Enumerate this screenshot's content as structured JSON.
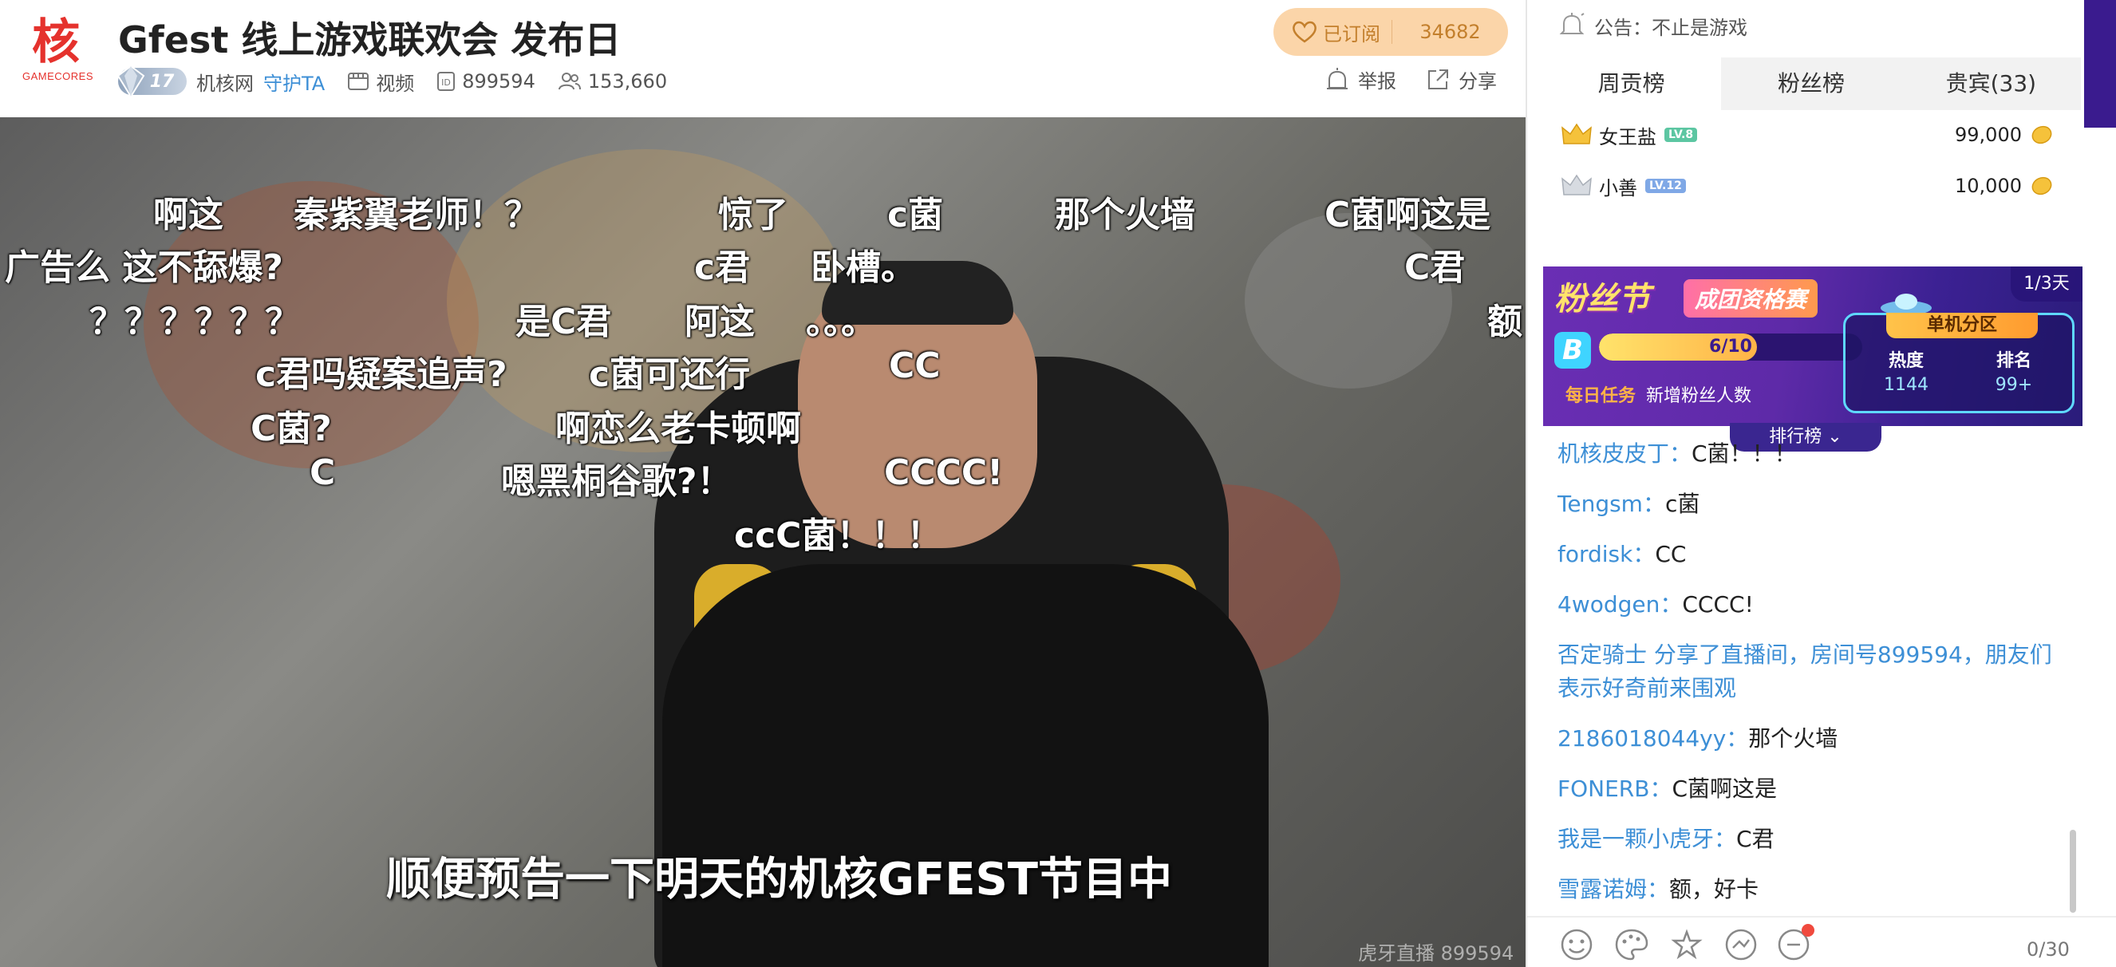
{
  "header": {
    "logo_glyph": "核",
    "logo_text": "GAMECORES",
    "title": "Gfest 线上游戏联欢会 发布日",
    "level": "17",
    "streamer": "机核网",
    "guard_link": "守护TA",
    "category": "视频",
    "room_id": "899594",
    "viewers": "153,660",
    "subscribe_label": "已订阅",
    "subscribe_count": "34682",
    "report_label": "举报",
    "share_label": "分享"
  },
  "video": {
    "danmaku": [
      {
        "text": "啊这",
        "row": 1,
        "col": 192
      },
      {
        "text": "秦紫翼老师！？",
        "row": 1,
        "col": 368
      },
      {
        "text": "惊了",
        "row": 1,
        "col": 900
      },
      {
        "text": "c菌",
        "row": 1,
        "col": 1112
      },
      {
        "text": "那个火墙",
        "row": 1,
        "col": 1322
      },
      {
        "text": "C菌啊这是",
        "row": 1,
        "col": 1660
      },
      {
        "text": "广告么 这不舔爆?",
        "row": 2,
        "col": 6
      },
      {
        "text": "c君",
        "row": 2,
        "col": 870
      },
      {
        "text": "卧槽。",
        "row": 2,
        "col": 1016
      },
      {
        "text": "C君",
        "row": 2,
        "col": 1760
      },
      {
        "text": "？？？？？？",
        "row": 3,
        "col": 112
      },
      {
        "text": "是C君",
        "row": 3,
        "col": 646
      },
      {
        "text": "阿这",
        "row": 3,
        "col": 858
      },
      {
        "text": "。。。",
        "row": 3,
        "col": 1010
      },
      {
        "text": "额",
        "row": 3,
        "col": 1864
      },
      {
        "text": "c君吗疑案追声?",
        "row": 4,
        "col": 320
      },
      {
        "text": "c菌可还行",
        "row": 4,
        "col": 738
      },
      {
        "text": "CC",
        "row": 4,
        "col": 1114
      },
      {
        "text": "C菌?",
        "row": 5,
        "col": 314
      },
      {
        "text": "啊恋么老卡顿啊",
        "row": 5,
        "col": 696
      },
      {
        "text": "C",
        "row": 6,
        "col": 388
      },
      {
        "text": "嗯黑桐谷歌?！",
        "row": 6,
        "col": 628
      },
      {
        "text": "CCCC!",
        "row": 6,
        "col": 1108
      },
      {
        "text": "ccC菌！！！",
        "row": 7,
        "col": 920
      }
    ],
    "subtitle": "顺便预告一下明天的机核GFEST节目中",
    "watermark": "虎牙直播 899594"
  },
  "sidebar": {
    "notice_label": "公告：",
    "notice_text": "不止是游戏",
    "tabs": [
      "周贡榜",
      "粉丝榜",
      "贵宾(33)"
    ],
    "active_tab": 0,
    "ranking": [
      {
        "name": "女王盐",
        "level": "LV.8",
        "score": "99,000",
        "crown": "gold"
      },
      {
        "name": "小善",
        "level": "LV.12",
        "score": "10,000",
        "crown": "silver"
      }
    ],
    "banner": {
      "title": "粉丝节",
      "badge": "成团资格赛",
      "days": "1/3天",
      "progress": "6/10",
      "progress_value": 0.6,
      "task_label": "每日任务",
      "task_text": "新增粉丝人数",
      "division": "单机分区",
      "heat_label": "热度",
      "heat_value": "1144",
      "rank_label": "排名",
      "rank_value": "99+",
      "rank_link": "排行榜"
    },
    "chat": [
      {
        "nick": "机核皮皮丁：",
        "text": "C菌！！！"
      },
      {
        "nick": "Tengsm：",
        "text": "c菌"
      },
      {
        "nick": "fordisk：",
        "text": "CC"
      },
      {
        "nick": "4wodgen：",
        "text": "CCCC!"
      },
      {
        "system": "否定骑士 分享了直播间，房间号899594，朋友们表示好奇前来围观"
      },
      {
        "nick": "2186018044yy：",
        "text": "那个火墙"
      },
      {
        "nick": "FONERB：",
        "text": "C菌啊这是"
      },
      {
        "nick": "我是一颗小虎牙：",
        "text": "C君"
      },
      {
        "nick": "雪露诺姆：",
        "text": "额，好卡"
      }
    ],
    "counter": "0/30"
  },
  "colors": {
    "accent_blue": "#3d8fd6",
    "logo_red": "#e5322d",
    "subscribe_bg": "#fbd5a9",
    "banner_purple": "#5e2aa8"
  },
  "icons": [
    "bell-icon",
    "heart-icon",
    "film-icon",
    "id-icon",
    "users-icon",
    "report-icon",
    "share-icon",
    "emoji-icon",
    "palette-icon",
    "effects-icon",
    "gift-icon",
    "notification-icon"
  ]
}
